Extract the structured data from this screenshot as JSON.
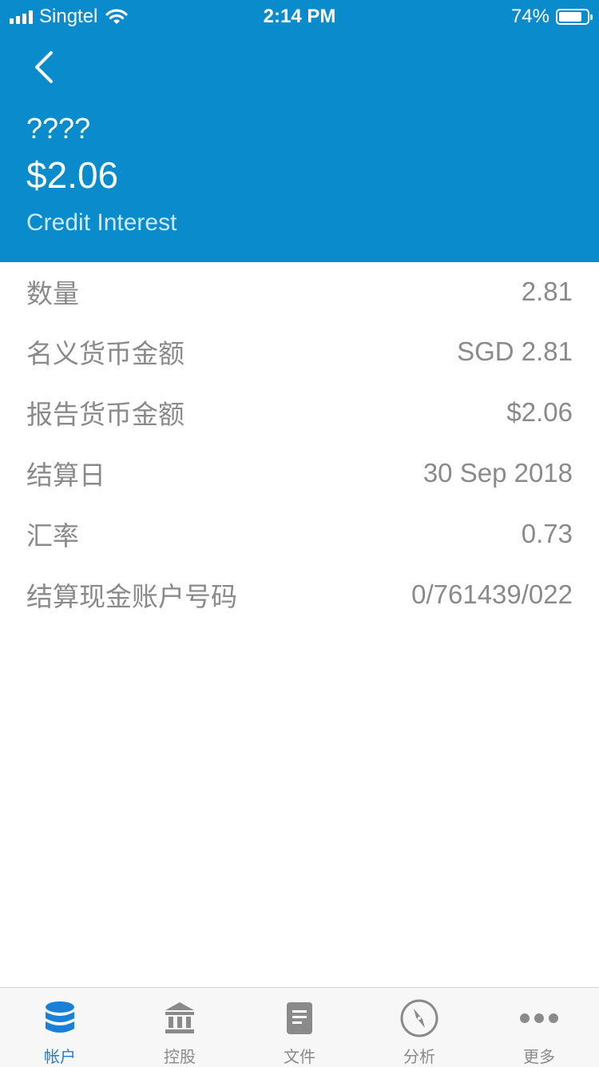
{
  "status_bar": {
    "carrier": "Singtel",
    "time": "2:14 PM",
    "battery": "74%",
    "battery_level": 0.74
  },
  "header": {
    "subtitle": "????",
    "amount": "$2.06",
    "type": "Credit Interest",
    "back_icon": "chevron-left-icon"
  },
  "details": [
    {
      "label": "数量",
      "value": "2.81"
    },
    {
      "label": "名义货币金额",
      "value": "SGD 2.81"
    },
    {
      "label": "报告货币金额",
      "value": "$2.06"
    },
    {
      "label": "结算日",
      "value": "30 Sep 2018"
    },
    {
      "label": "汇率",
      "value": "0.73"
    },
    {
      "label": "结算现金账户号码",
      "value": "0/761439/022"
    }
  ],
  "tabs": [
    {
      "label": "帐户",
      "icon": "database-icon",
      "active": true
    },
    {
      "label": "控股",
      "icon": "bank-icon",
      "active": false
    },
    {
      "label": "文件",
      "icon": "document-icon",
      "active": false
    },
    {
      "label": "分析",
      "icon": "compass-icon",
      "active": false
    },
    {
      "label": "更多",
      "icon": "more-icon",
      "active": false
    }
  ],
  "colors": {
    "header_bg": "#0a8ccc",
    "active_tab": "#1a7fd6",
    "inactive_tab": "#8a8a8a"
  }
}
